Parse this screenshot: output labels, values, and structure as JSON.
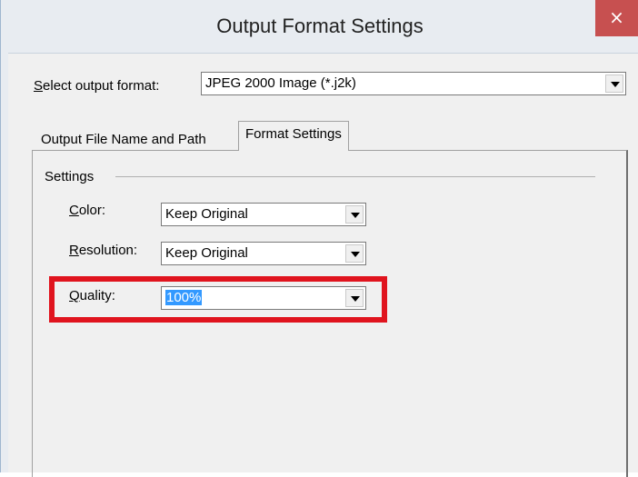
{
  "window": {
    "title": "Output Format Settings",
    "close_glyph": "×"
  },
  "format": {
    "label_accel": "S",
    "label_rest": "elect output format:",
    "value": "JPEG 2000 Image (*.j2k)"
  },
  "tabs": [
    {
      "label": "Output File Name and Path",
      "active": false
    },
    {
      "label": "Format Settings",
      "active": true
    }
  ],
  "settings": {
    "group_label": "Settings",
    "color": {
      "label_accel": "C",
      "label_rest": "olor:",
      "value": "Keep Original"
    },
    "resolution": {
      "label_accel": "R",
      "label_rest": "esolution:",
      "value": "Keep Original"
    },
    "quality": {
      "label_accel": "Q",
      "label_rest": "uality:",
      "value": "100%"
    }
  },
  "colors": {
    "close_button": "#c75050",
    "highlight_box": "#e0141e",
    "selection": "#3399ff"
  },
  "icons": {
    "close": "close-icon",
    "dropdown": "chevron-down-icon"
  }
}
